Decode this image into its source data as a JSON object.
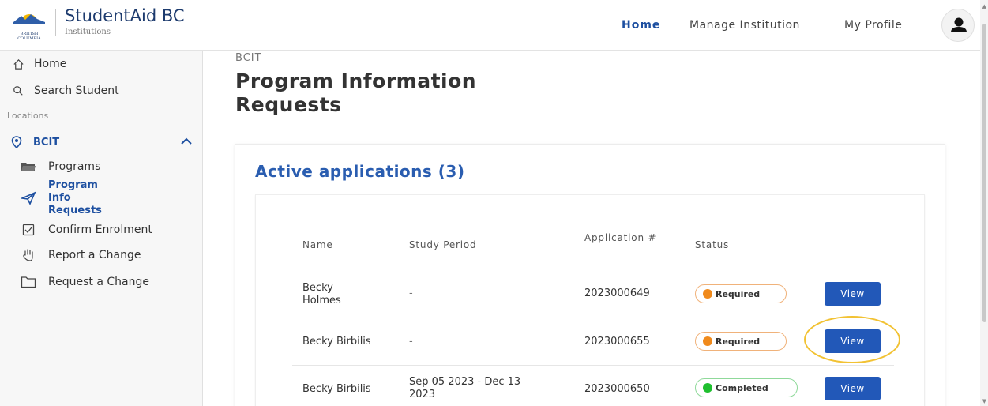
{
  "header": {
    "brand_title": "StudentAid BC",
    "brand_subtitle": "Institutions",
    "logo_text_line1": "BRITISH",
    "logo_text_line2": "COLUMBIA",
    "nav": [
      {
        "label": "Home",
        "active": true
      },
      {
        "label": "Manage Institution",
        "active": false
      },
      {
        "label": "My Profile",
        "active": false
      }
    ]
  },
  "sidebar": {
    "home": "Home",
    "search": "Search Student",
    "section_label": "Locations",
    "location": "BCIT",
    "items": [
      {
        "label": "Programs",
        "icon": "folder-icon"
      },
      {
        "label": "Program Info Requests",
        "icon": "paper-plane-icon",
        "active": true
      },
      {
        "label": "Confirm Enrolment",
        "icon": "checkbox-icon"
      },
      {
        "label": "Report a Change",
        "icon": "hand-icon"
      },
      {
        "label": "Request a Change",
        "icon": "folder-outline-icon"
      }
    ]
  },
  "main": {
    "breadcrumb": "BCIT",
    "title": "Program Information Requests",
    "card_title": "Active applications (3)",
    "columns": [
      "Name",
      "Study Period",
      "Application #",
      "Status"
    ],
    "rows": [
      {
        "name": "Becky Holmes",
        "study_period": "-",
        "application": "2023000649",
        "status": "Required",
        "action": "View"
      },
      {
        "name": "Becky Birbilis",
        "study_period": "-",
        "application": "2023000655",
        "status": "Required",
        "action": "View"
      },
      {
        "name": "Becky Birbilis",
        "study_period": "Sep 05 2023 - Dec 13 2023",
        "application": "2023000650",
        "status": "Completed",
        "action": "View"
      }
    ]
  },
  "colors": {
    "brand_blue": "#1d4fa0",
    "button_blue": "#2258b8",
    "required_orange": "#f08a1c",
    "completed_green": "#1fbf2f",
    "highlight_yellow": "#f2c233"
  }
}
